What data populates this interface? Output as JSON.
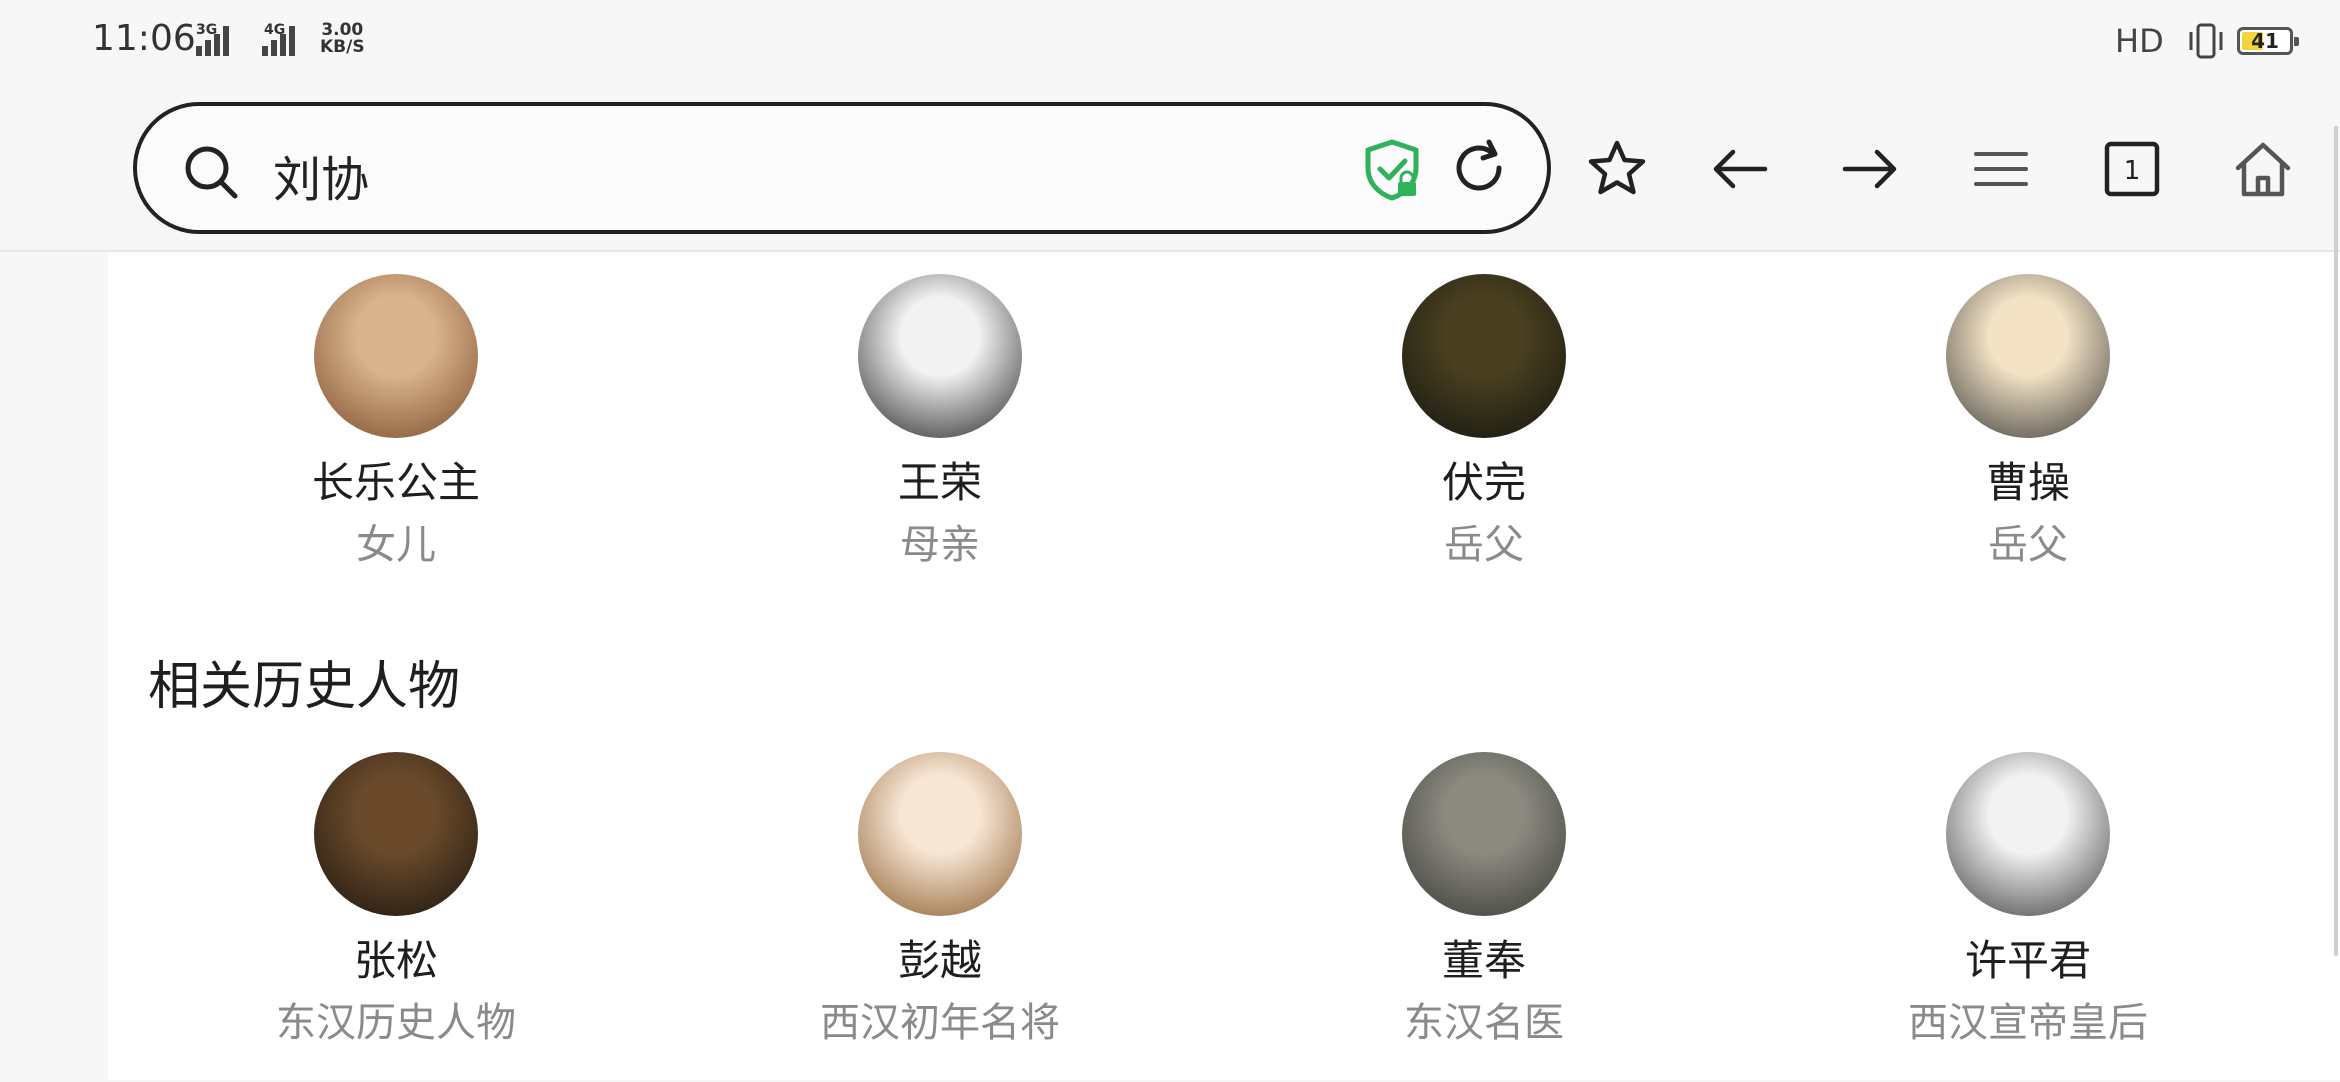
{
  "status_bar": {
    "time": "11:06",
    "sig1_label": "3G",
    "sig2_label": "4G",
    "speed_value": "3.00",
    "speed_unit": "KB/S",
    "hd_label": "HD",
    "battery": "41"
  },
  "url_bar": {
    "query": "刘协"
  },
  "family_row": [
    {
      "name": "长乐公主",
      "relation": "女儿",
      "colors": [
        "#d9b48c",
        "#7a4a2a"
      ]
    },
    {
      "name": "王荣",
      "relation": "母亲",
      "colors": [
        "#f2f2f2",
        "#222222"
      ]
    },
    {
      "name": "伏完",
      "relation": "岳父",
      "colors": [
        "#4a4020",
        "#121410"
      ]
    },
    {
      "name": "曹操",
      "relation": "岳父",
      "colors": [
        "#f3e2c4",
        "#3a3a3a"
      ]
    }
  ],
  "related_section": {
    "title": "相关历史人物"
  },
  "related_row": [
    {
      "name": "张松",
      "relation": "东汉历史人物",
      "colors": [
        "#6a4a2a",
        "#1a1410"
      ]
    },
    {
      "name": "彭越",
      "relation": "西汉初年名将",
      "colors": [
        "#f7e6d4",
        "#8a5a2a"
      ]
    },
    {
      "name": "董奉",
      "relation": "东汉名医",
      "colors": [
        "#8a8a80",
        "#3a3a36"
      ]
    },
    {
      "name": "许平君",
      "relation": "西汉宣帝皇后",
      "colors": [
        "#f2f2f2",
        "#3a3a3a"
      ]
    }
  ]
}
